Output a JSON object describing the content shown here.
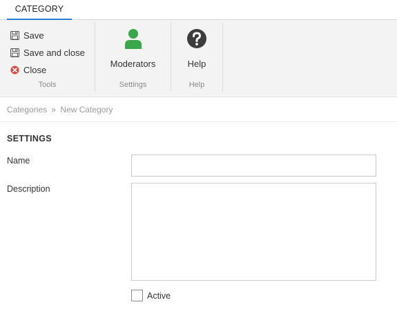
{
  "tabs": [
    {
      "label": "CATEGORY",
      "active": true
    }
  ],
  "ribbon": {
    "tools": {
      "save_label": "Save",
      "save_close_label": "Save and close",
      "close_label": "Close",
      "group_label": "Tools"
    },
    "settings": {
      "moderators_label": "Moderators",
      "group_label": "Settings"
    },
    "help": {
      "help_label": "Help",
      "group_label": "Help"
    }
  },
  "breadcrumb": {
    "root": "Categories",
    "separator": "»",
    "current": "New Category"
  },
  "form": {
    "section_title": "SETTINGS",
    "name_label": "Name",
    "name_value": "",
    "description_label": "Description",
    "description_value": "",
    "active_label": "Active",
    "active_checked": false
  },
  "colors": {
    "tab_accent": "#2a7bd3",
    "moderators_icon": "#3aa84a",
    "help_icon": "#3d3d3d",
    "close_icon": "#e0453a"
  },
  "icons": {
    "save": "floppy-disk-icon",
    "save_close": "floppy-disk-icon",
    "close": "close-circle-icon",
    "moderators": "user-icon",
    "help": "question-circle-icon"
  }
}
